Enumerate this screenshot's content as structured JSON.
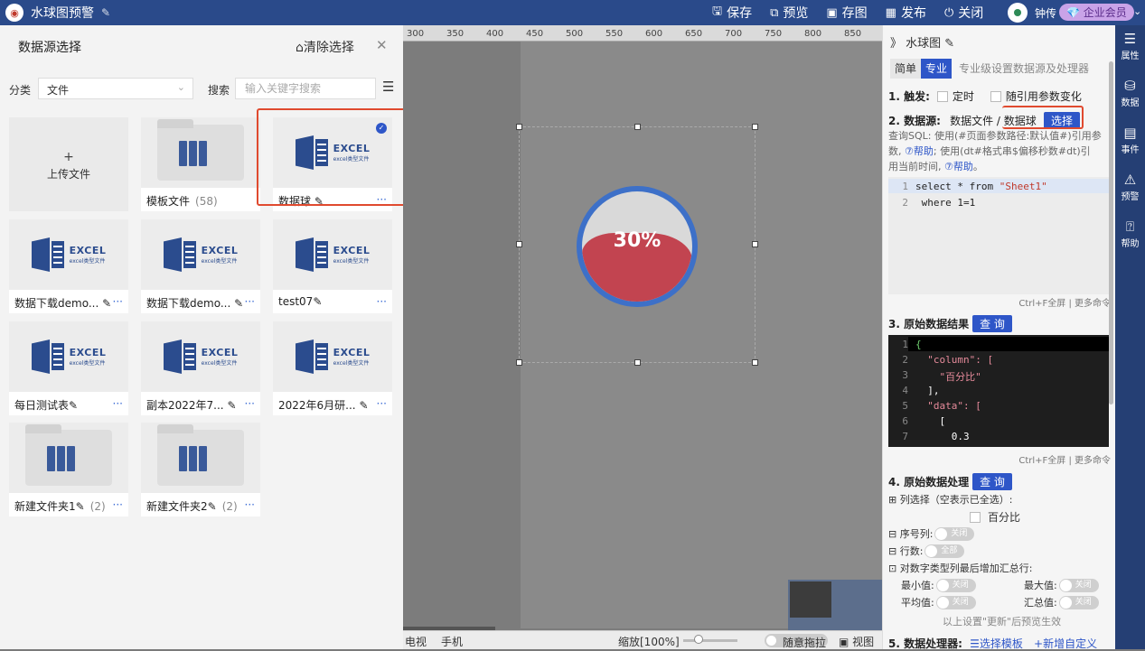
{
  "topbar": {
    "title": "水球图预警",
    "actions": [
      {
        "icon": "save-icon",
        "glyph": "🖫",
        "label": "保存"
      },
      {
        "icon": "preview-icon",
        "glyph": "⧉",
        "label": "预览"
      },
      {
        "icon": "image-icon",
        "glyph": "▣",
        "label": "存图"
      },
      {
        "icon": "publish-icon",
        "glyph": "▦",
        "label": "发布"
      },
      {
        "icon": "power-icon",
        "glyph": "⏻",
        "label": "关闭"
      }
    ],
    "user_name": "钟传",
    "vip_label": "💎 企业会员"
  },
  "left_panel": {
    "title": "数据源选择",
    "clear_label": "⌂清除选择",
    "category_label": "分类",
    "category_value": "文件",
    "search_label": "搜索",
    "search_placeholder": "输入关键字搜索",
    "upload_plus": "+",
    "upload_label": "上传文件",
    "cards": [
      {
        "name": "模板文件",
        "count": "(58)",
        "type": "folder"
      },
      {
        "name": "数据球",
        "type": "excel",
        "selected": true
      },
      {
        "name": "数据下载demo...",
        "type": "excel"
      },
      {
        "name": "数据下载demo...",
        "type": "excel"
      },
      {
        "name": "test07",
        "type": "excel"
      },
      {
        "name": "每日测试表",
        "type": "excel"
      },
      {
        "name": "副本2022年7...",
        "type": "excel"
      },
      {
        "name": "2022年6月研...",
        "type": "excel"
      },
      {
        "name": "新建文件夹1",
        "count": "(2)",
        "type": "folder"
      },
      {
        "name": "新建文件夹2",
        "count": "(2)",
        "type": "folder"
      }
    ],
    "excel_title": "EXCEL",
    "excel_sub": "excel类型文件"
  },
  "canvas": {
    "ruler_ticks": [
      "300",
      "350",
      "400",
      "450",
      "500",
      "550",
      "600",
      "650",
      "700",
      "750",
      "800",
      "850"
    ],
    "gauge_value": 0.3,
    "gauge_text": "30%",
    "view_pc": "电视",
    "view_mobile": "手机",
    "zoom_label": "缩放[100%]",
    "drag_label": "随意拖拉",
    "view_label": "▣ 视图"
  },
  "right_panel": {
    "breadcrumb": "》 水球图 ✎",
    "tab_simple": "简单",
    "tab_pro": "专业",
    "tab_note": "专业级设置数据源及处理器",
    "trigger_title": "1. 触发:",
    "trigger_timer": "定时",
    "trigger_param": "随引用参数变化",
    "source_title": "2. 数据源:",
    "source_value": "数据文件 / 数据球",
    "select_btn": "选择",
    "sql_note1": "查询SQL: 使用(#页面参数路径:默认值#)引用参",
    "sql_note2": "数, ",
    "help1": "⑦帮助",
    "sql_note3": "; 使用(dt#格式串$偏移秒数#dt)引",
    "sql_note4": "用当前时间, ",
    "help2": "⑦帮助",
    "sql_note5": "。",
    "sql_lines": [
      {
        "n": "1",
        "parts": [
          "select * from ",
          "\"Sheet1\""
        ]
      },
      {
        "n": "2",
        "parts": [
          " where 1=1",
          ""
        ]
      }
    ],
    "ctrlf": "Ctrl+F全屏 | 更多命令",
    "raw_title": "3. 原始数据结果",
    "query_btn": "查 询",
    "json_lines": [
      {
        "n": "1",
        "t": "{"
      },
      {
        "n": "2",
        "t": "  \"column\": ["
      },
      {
        "n": "3",
        "t": "    \"百分比\""
      },
      {
        "n": "4",
        "t": "  ],"
      },
      {
        "n": "5",
        "t": "  \"data\": ["
      },
      {
        "n": "6",
        "t": "    ["
      },
      {
        "n": "7",
        "t": "      0.3"
      }
    ],
    "proc_title": "4. 原始数据处理",
    "col_select": "⊞ 列选择（空表示已全选）:",
    "col_name": "百分比",
    "seq_label": "⊟ 序号列:",
    "rows_label": "⊟ 行数:",
    "sum_label": "⊡ 对数字类型列最后增加汇总行:",
    "min_label": "最小值:",
    "max_label": "最大值:",
    "avg_label": "平均值:",
    "total_label": "汇总值:",
    "off": "关闭",
    "all": "全部",
    "update_note": "以上设置\"更新\"后预览生效",
    "processor_title": "5. 数据处理器:",
    "tpl_link": "☰选择模板",
    "custom_link": "+新增自定义"
  },
  "sidebar": [
    {
      "icon": "properties-icon",
      "glyph": "☰",
      "label": "属性"
    },
    {
      "icon": "data-icon",
      "glyph": "⛁",
      "label": "数据"
    },
    {
      "icon": "event-icon",
      "glyph": "▤",
      "label": "事件"
    },
    {
      "icon": "alert-icon",
      "glyph": "⚠",
      "label": "预警"
    },
    {
      "icon": "help-icon",
      "glyph": "⍰",
      "label": "帮助"
    }
  ]
}
